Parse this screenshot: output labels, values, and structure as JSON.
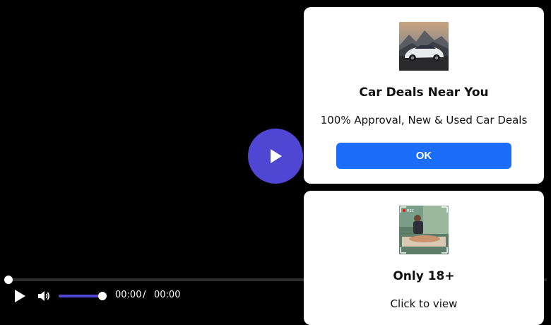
{
  "colors": {
    "accent": "#5046d4",
    "button_blue": "#1b6ef9",
    "background": "#000000",
    "card": "#ffffff"
  },
  "player": {
    "big_play_icon": "play-icon",
    "progress": 0,
    "volume": 1,
    "current_time": "00:00",
    "separator": "/",
    "duration": "00:00"
  },
  "ads": [
    {
      "thumb_icon": "car-image",
      "title": "Car Deals Near You",
      "description": "100% Approval, New & Used Car Deals",
      "button_label": "OK"
    },
    {
      "thumb_icon": "camera-rec-image",
      "rec_label": "REC",
      "title": "Only 18+",
      "description": "Click to view"
    }
  ]
}
